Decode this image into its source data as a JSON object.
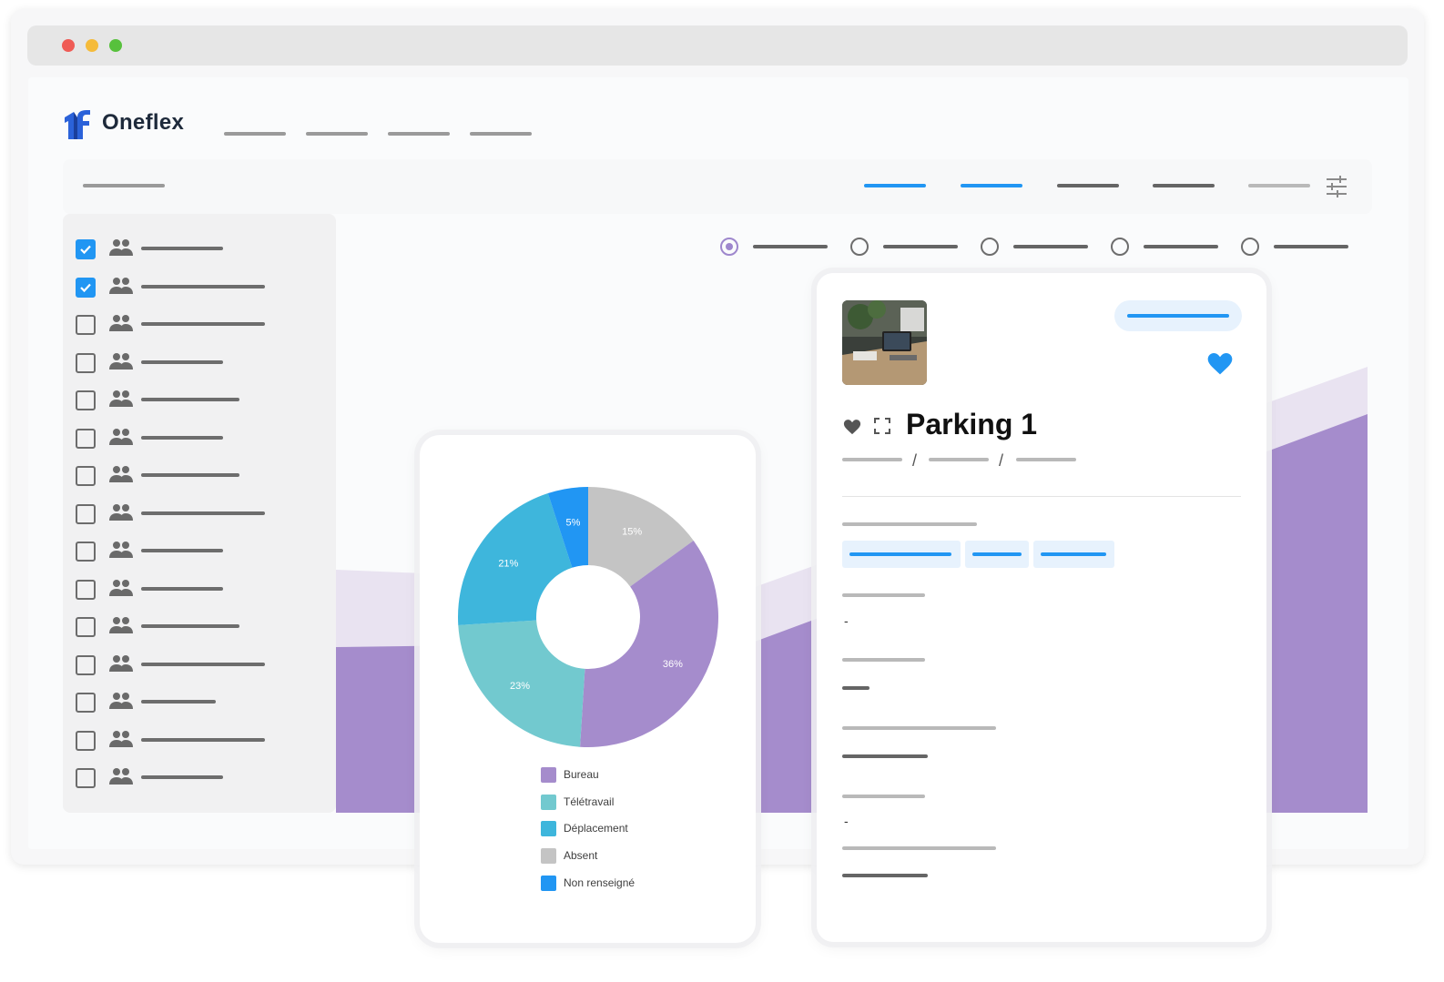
{
  "window": {
    "controls": [
      "close-dot",
      "minimize-dot",
      "zoom-dot"
    ]
  },
  "header": {
    "brand": "Oneflex",
    "nav_items": 4
  },
  "sidebar": {
    "items": [
      {
        "checked": true
      },
      {
        "checked": true
      },
      {
        "checked": false
      },
      {
        "checked": false
      },
      {
        "checked": false
      },
      {
        "checked": false
      },
      {
        "checked": false
      },
      {
        "checked": false
      },
      {
        "checked": false
      },
      {
        "checked": false
      },
      {
        "checked": false
      },
      {
        "checked": false
      },
      {
        "checked": false
      },
      {
        "checked": false
      },
      {
        "checked": false
      }
    ]
  },
  "radio_options": {
    "selected_index": 0,
    "count": 5
  },
  "chart_data": {
    "type": "pie",
    "categories": [
      "Bureau",
      "Télétravail",
      "Déplacement",
      "Absent",
      "Non renseigné"
    ],
    "values": [
      36,
      23,
      21,
      15,
      5
    ],
    "value_labels": [
      "36%",
      "23%",
      "21%",
      "15%",
      "5%"
    ],
    "colors": [
      "#a58ccc",
      "#72c9cf",
      "#3eb6dc",
      "#c4c4c4",
      "#2196f3"
    ],
    "donut": true
  },
  "detail": {
    "title": "Parking 1",
    "breadcrumb_separator": "/",
    "favorite_color": "#2196f3",
    "field_dash": "-"
  },
  "colors": {
    "accent": "#2196f3",
    "area_light": "#e9e3f1",
    "area_dark": "#a58ccc"
  }
}
